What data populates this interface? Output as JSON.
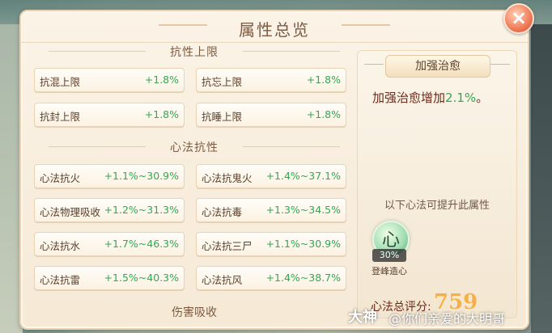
{
  "title": "属性总览",
  "sections": [
    {
      "title": "抗性上限",
      "items": [
        {
          "label": "抗混上限",
          "value": "+1.8%"
        },
        {
          "label": "抗忘上限",
          "value": "+1.8%"
        },
        {
          "label": "抗封上限",
          "value": "+1.8%"
        },
        {
          "label": "抗睡上限",
          "value": "+1.8%"
        }
      ]
    },
    {
      "title": "心法抗性",
      "items": [
        {
          "label": "心法抗火",
          "value": "+1.1%~30.9%"
        },
        {
          "label": "心法抗鬼火",
          "value": "+1.4%~37.1%"
        },
        {
          "label": "心法物理吸收",
          "value": "+1.2%~31.3%"
        },
        {
          "label": "心法抗毒",
          "value": "+1.3%~34.5%"
        },
        {
          "label": "心法抗水",
          "value": "+1.7%~46.3%"
        },
        {
          "label": "心法抗三尸",
          "value": "+1.1%~30.9%"
        },
        {
          "label": "心法抗雷",
          "value": "+1.5%~40.3%"
        },
        {
          "label": "心法抗风",
          "value": "+1.4%~38.7%"
        }
      ]
    },
    {
      "title": "伤害吸收"
    }
  ],
  "detail": {
    "tag": "加强治愈",
    "desc_prefix": "加强治愈增加",
    "desc_value": "2.1%",
    "desc_suffix": "。",
    "hint": "以下心法可提升此属性",
    "xinfa": {
      "glyph": "心",
      "percent": "30%",
      "name": "登峰造心"
    },
    "score_label": "心法总评分:",
    "score_value": "759"
  },
  "close_glyph": "×",
  "watermark": {
    "brand": "大神",
    "text": "@你们亲爱的大明哥"
  },
  "colors": {
    "positive": "#32a853",
    "accent": "#f5b04a",
    "title": "#7b5b42"
  }
}
